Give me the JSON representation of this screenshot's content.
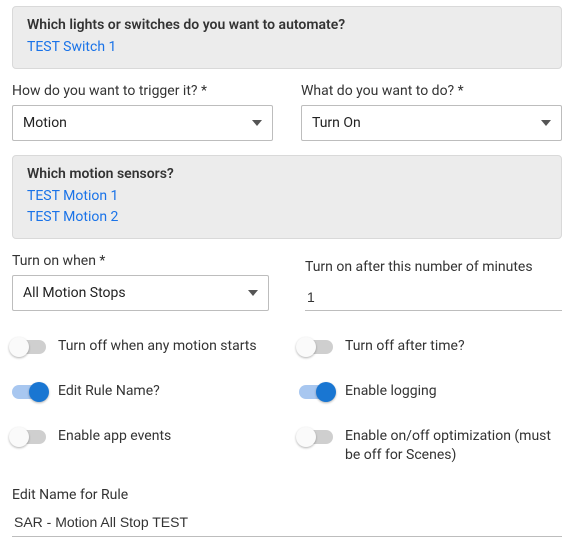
{
  "box1": {
    "question": "Which lights or switches do you want to automate?",
    "items": [
      "TEST Switch 1"
    ]
  },
  "trigger": {
    "label": "How do you want to trigger it? *",
    "value": "Motion"
  },
  "action": {
    "label": "What do you want to do? *",
    "value": "Turn On"
  },
  "box2": {
    "question": "Which motion sensors?",
    "items": [
      "TEST Motion 1",
      "TEST Motion 2"
    ]
  },
  "turnOnWhen": {
    "label": "Turn on when *",
    "value": "All Motion Stops"
  },
  "turnOnAfter": {
    "label": "Turn on after this number of minutes",
    "value": "1"
  },
  "toggles": {
    "turnOffMotionStarts": "Turn off when any motion starts",
    "turnOffAfterTime": "Turn off after time?",
    "editRuleName": "Edit Rule Name?",
    "enableLogging": "Enable logging",
    "enableAppEvents": "Enable app events",
    "enableOptimization": "Enable on/off optimization (must be off for Scenes)"
  },
  "editName": {
    "label": "Edit Name for Rule",
    "value": "SAR - Motion All Stop TEST"
  }
}
